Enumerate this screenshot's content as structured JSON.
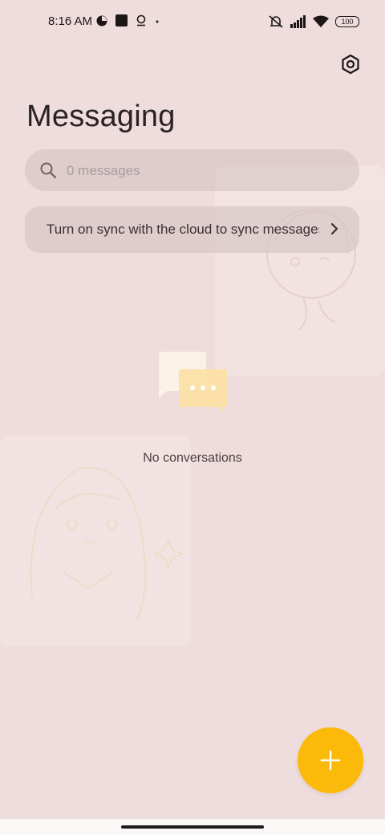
{
  "status_bar": {
    "time": "8:16 AM",
    "battery": "100",
    "left_icons": [
      "data-saver-icon",
      "square-notification-icon",
      "location-pin-icon",
      "dot-icon"
    ],
    "right_icons": [
      "vibrate-off-icon",
      "signal-icon",
      "wifi-icon",
      "battery-icon"
    ]
  },
  "header": {
    "title": "Messaging",
    "settings_icon": "settings-hex-icon"
  },
  "search": {
    "placeholder": "0 messages",
    "icon": "search-icon"
  },
  "sync_banner": {
    "text": "Turn on sync with the cloud to sync messages"
  },
  "empty_state": {
    "icon": "chat-bubbles-icon",
    "text": "No conversations"
  },
  "fab": {
    "icon": "plus-icon",
    "color": "#fbba0a"
  },
  "colors": {
    "background": "#efdcdc",
    "accent": "#fbba0a"
  }
}
